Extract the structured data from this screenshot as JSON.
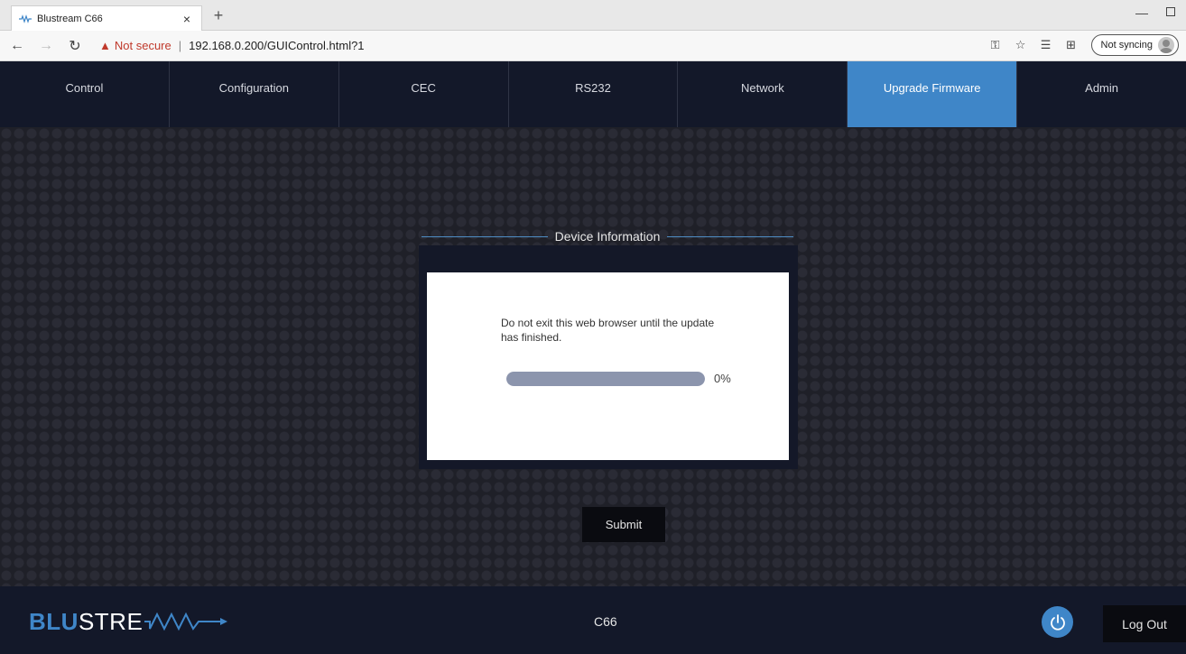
{
  "browser": {
    "tab_title": "Blustream C66",
    "tab_close": "×",
    "new_tab": "+",
    "not_secure": "Not secure",
    "url_separator": "|",
    "url": "192.168.0.200/GUIControl.html?1",
    "sync_label": "Not syncing"
  },
  "nav": {
    "items": [
      {
        "label": "Control"
      },
      {
        "label": "Configuration"
      },
      {
        "label": "CEC"
      },
      {
        "label": "RS232"
      },
      {
        "label": "Network"
      },
      {
        "label": "Upgrade Firmware"
      },
      {
        "label": "Admin"
      }
    ],
    "active": "Upgrade Firmware"
  },
  "panel": {
    "legend": "Device Information",
    "message": "Do not exit this web browser until the update has finished.",
    "progress": 0,
    "progress_label": "0%"
  },
  "submit_label": "Submit",
  "footer": {
    "logo_blu": "BLU",
    "logo_strea": "STRE",
    "model": "C66",
    "logout_label": "Log Out"
  },
  "colors": {
    "accent": "#3f86c8",
    "nav_bg": "#131829",
    "progress_fill": "#8c95ad"
  }
}
